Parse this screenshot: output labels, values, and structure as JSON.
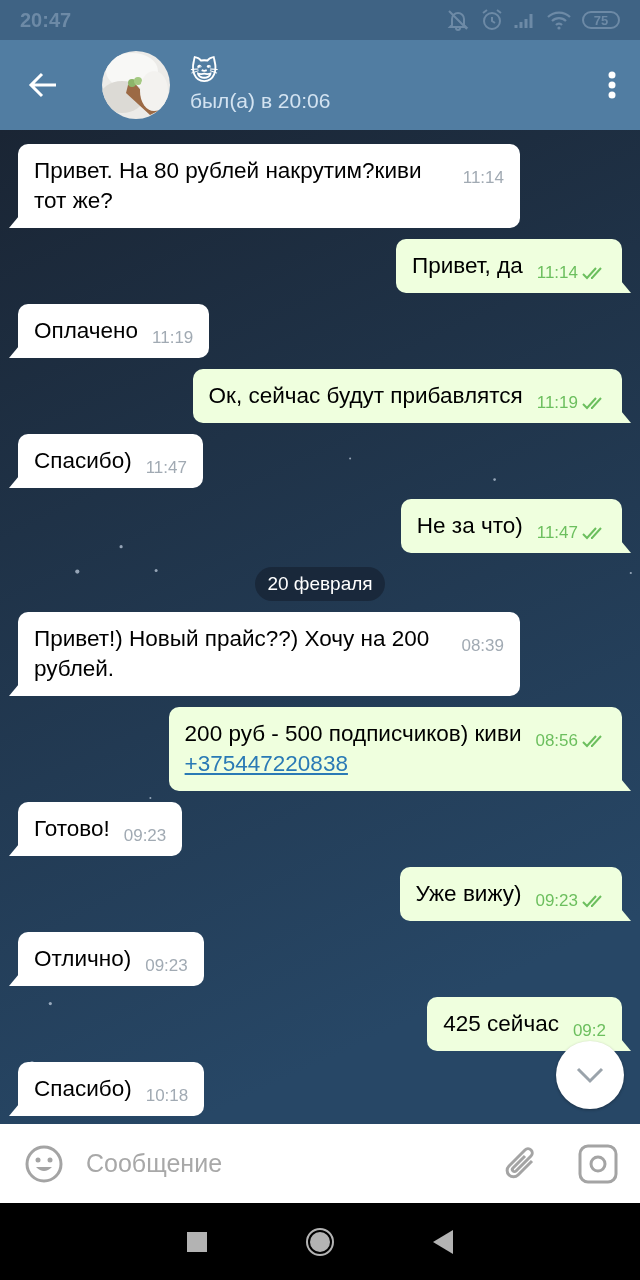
{
  "status_bar": {
    "time": "20:47",
    "battery": "75"
  },
  "header": {
    "title": "😺",
    "status": "был(а) в 20:06"
  },
  "messages": [
    {
      "kind": "incoming",
      "text": "Привет. На 80 рублей накрутим?киви тот же?",
      "time": "11:14"
    },
    {
      "kind": "outgoing",
      "text": "Привет, да",
      "time": "11:14",
      "read": true
    },
    {
      "kind": "incoming",
      "text": "Оплачено",
      "time": "11:19"
    },
    {
      "kind": "outgoing",
      "text": "Ок, сейчас будут прибавлятся",
      "time": "11:19",
      "read": true
    },
    {
      "kind": "incoming",
      "text": "Спасибо)",
      "time": "11:47"
    },
    {
      "kind": "outgoing",
      "text": "Не за что)",
      "time": "11:47",
      "read": true
    },
    {
      "kind": "date",
      "text": "20 февраля"
    },
    {
      "kind": "incoming",
      "text": "Привет!) Новый прайс??) Хочу на 200 рублей.",
      "time": "08:39"
    },
    {
      "kind": "outgoing",
      "text": "200 руб - 500 подписчиков) киви",
      "link": "+375447220838",
      "time": "08:56",
      "read": true
    },
    {
      "kind": "incoming",
      "text": "Готово!",
      "time": "09:23"
    },
    {
      "kind": "outgoing",
      "text": "Уже вижу)",
      "time": "09:23",
      "read": true
    },
    {
      "kind": "incoming",
      "text": "Отлично)",
      "time": "09:23"
    },
    {
      "kind": "outgoing",
      "text": "425 сейчас",
      "time": "09:2"
    },
    {
      "kind": "incoming",
      "text": "Спасибо)",
      "time": "10:18"
    }
  ],
  "composer": {
    "placeholder": "Сообщение"
  }
}
